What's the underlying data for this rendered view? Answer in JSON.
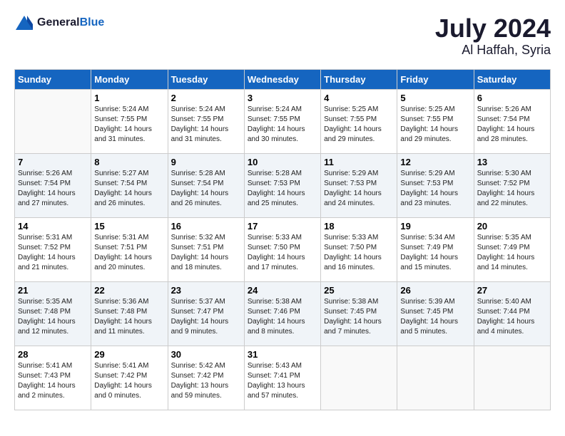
{
  "header": {
    "logo_line1": "General",
    "logo_line2": "Blue",
    "month": "July 2024",
    "location": "Al Haffah, Syria"
  },
  "weekdays": [
    "Sunday",
    "Monday",
    "Tuesday",
    "Wednesday",
    "Thursday",
    "Friday",
    "Saturday"
  ],
  "weeks": [
    [
      {
        "day": "",
        "info": ""
      },
      {
        "day": "1",
        "info": "Sunrise: 5:24 AM\nSunset: 7:55 PM\nDaylight: 14 hours\nand 31 minutes."
      },
      {
        "day": "2",
        "info": "Sunrise: 5:24 AM\nSunset: 7:55 PM\nDaylight: 14 hours\nand 31 minutes."
      },
      {
        "day": "3",
        "info": "Sunrise: 5:24 AM\nSunset: 7:55 PM\nDaylight: 14 hours\nand 30 minutes."
      },
      {
        "day": "4",
        "info": "Sunrise: 5:25 AM\nSunset: 7:55 PM\nDaylight: 14 hours\nand 29 minutes."
      },
      {
        "day": "5",
        "info": "Sunrise: 5:25 AM\nSunset: 7:55 PM\nDaylight: 14 hours\nand 29 minutes."
      },
      {
        "day": "6",
        "info": "Sunrise: 5:26 AM\nSunset: 7:54 PM\nDaylight: 14 hours\nand 28 minutes."
      }
    ],
    [
      {
        "day": "7",
        "info": "Sunrise: 5:26 AM\nSunset: 7:54 PM\nDaylight: 14 hours\nand 27 minutes."
      },
      {
        "day": "8",
        "info": "Sunrise: 5:27 AM\nSunset: 7:54 PM\nDaylight: 14 hours\nand 26 minutes."
      },
      {
        "day": "9",
        "info": "Sunrise: 5:28 AM\nSunset: 7:54 PM\nDaylight: 14 hours\nand 26 minutes."
      },
      {
        "day": "10",
        "info": "Sunrise: 5:28 AM\nSunset: 7:53 PM\nDaylight: 14 hours\nand 25 minutes."
      },
      {
        "day": "11",
        "info": "Sunrise: 5:29 AM\nSunset: 7:53 PM\nDaylight: 14 hours\nand 24 minutes."
      },
      {
        "day": "12",
        "info": "Sunrise: 5:29 AM\nSunset: 7:53 PM\nDaylight: 14 hours\nand 23 minutes."
      },
      {
        "day": "13",
        "info": "Sunrise: 5:30 AM\nSunset: 7:52 PM\nDaylight: 14 hours\nand 22 minutes."
      }
    ],
    [
      {
        "day": "14",
        "info": "Sunrise: 5:31 AM\nSunset: 7:52 PM\nDaylight: 14 hours\nand 21 minutes."
      },
      {
        "day": "15",
        "info": "Sunrise: 5:31 AM\nSunset: 7:51 PM\nDaylight: 14 hours\nand 20 minutes."
      },
      {
        "day": "16",
        "info": "Sunrise: 5:32 AM\nSunset: 7:51 PM\nDaylight: 14 hours\nand 18 minutes."
      },
      {
        "day": "17",
        "info": "Sunrise: 5:33 AM\nSunset: 7:50 PM\nDaylight: 14 hours\nand 17 minutes."
      },
      {
        "day": "18",
        "info": "Sunrise: 5:33 AM\nSunset: 7:50 PM\nDaylight: 14 hours\nand 16 minutes."
      },
      {
        "day": "19",
        "info": "Sunrise: 5:34 AM\nSunset: 7:49 PM\nDaylight: 14 hours\nand 15 minutes."
      },
      {
        "day": "20",
        "info": "Sunrise: 5:35 AM\nSunset: 7:49 PM\nDaylight: 14 hours\nand 14 minutes."
      }
    ],
    [
      {
        "day": "21",
        "info": "Sunrise: 5:35 AM\nSunset: 7:48 PM\nDaylight: 14 hours\nand 12 minutes."
      },
      {
        "day": "22",
        "info": "Sunrise: 5:36 AM\nSunset: 7:48 PM\nDaylight: 14 hours\nand 11 minutes."
      },
      {
        "day": "23",
        "info": "Sunrise: 5:37 AM\nSunset: 7:47 PM\nDaylight: 14 hours\nand 9 minutes."
      },
      {
        "day": "24",
        "info": "Sunrise: 5:38 AM\nSunset: 7:46 PM\nDaylight: 14 hours\nand 8 minutes."
      },
      {
        "day": "25",
        "info": "Sunrise: 5:38 AM\nSunset: 7:45 PM\nDaylight: 14 hours\nand 7 minutes."
      },
      {
        "day": "26",
        "info": "Sunrise: 5:39 AM\nSunset: 7:45 PM\nDaylight: 14 hours\nand 5 minutes."
      },
      {
        "day": "27",
        "info": "Sunrise: 5:40 AM\nSunset: 7:44 PM\nDaylight: 14 hours\nand 4 minutes."
      }
    ],
    [
      {
        "day": "28",
        "info": "Sunrise: 5:41 AM\nSunset: 7:43 PM\nDaylight: 14 hours\nand 2 minutes."
      },
      {
        "day": "29",
        "info": "Sunrise: 5:41 AM\nSunset: 7:42 PM\nDaylight: 14 hours\nand 0 minutes."
      },
      {
        "day": "30",
        "info": "Sunrise: 5:42 AM\nSunset: 7:42 PM\nDaylight: 13 hours\nand 59 minutes."
      },
      {
        "day": "31",
        "info": "Sunrise: 5:43 AM\nSunset: 7:41 PM\nDaylight: 13 hours\nand 57 minutes."
      },
      {
        "day": "",
        "info": ""
      },
      {
        "day": "",
        "info": ""
      },
      {
        "day": "",
        "info": ""
      }
    ]
  ]
}
